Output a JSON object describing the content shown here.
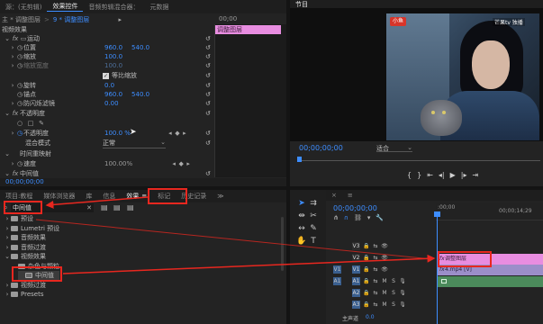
{
  "top_tabs": {
    "source": "源：(无剪辑)",
    "effect_controls": "效果控件",
    "audio_mixer": "音频剪辑混合器：",
    "metadata": "元数据",
    "program": "节目"
  },
  "effect_controls": {
    "breadcrumb_master": "主 * 调整图层",
    "breadcrumb_clip": "9 * 调整图层",
    "header_time": "00;00",
    "clip_label": "调整图层",
    "section_video": "视频效果",
    "motion": "运动",
    "position": {
      "label": "位置",
      "x": "960.0",
      "y": "540.0"
    },
    "scale": {
      "label": "缩放",
      "value": "100.0"
    },
    "scale_width": {
      "label": "缩放宽度",
      "value": "100.0"
    },
    "uniform_scale": "等比缩放",
    "rotation": {
      "label": "旋转",
      "value": "0.0"
    },
    "anchor": {
      "label": "锚点",
      "x": "960.0",
      "y": "540.0"
    },
    "flicker": {
      "label": "防闪烁滤镜",
      "value": "0.00"
    },
    "opacity": "不透明度",
    "opacity_value": {
      "label": "不透明度",
      "value": "100.0 %"
    },
    "blend": {
      "label": "混合模式",
      "value": "正常"
    },
    "time_remap": "时间重映射",
    "speed": {
      "label": "速度",
      "value": "100.00%"
    },
    "stabilizer": "中间值",
    "timecode": "00;00;00;00"
  },
  "program": {
    "timecode": "00;00;00;00",
    "fit": "适合",
    "watermark": "芒果tv 独播",
    "channel": "小鱼"
  },
  "bottom_tabs": {
    "project": "项目:教程",
    "media_browser": "媒体浏览器",
    "libraries": "库",
    "info": "信息",
    "effects": "效果",
    "markers": "标记",
    "history": "历史记录",
    "more": "≫"
  },
  "effects_panel": {
    "search_value": "中间值",
    "tree": [
      {
        "label": "预设",
        "indent": 0,
        "open": false
      },
      {
        "label": "Lumetri 预设",
        "indent": 0,
        "open": false
      },
      {
        "label": "音频效果",
        "indent": 0,
        "open": false
      },
      {
        "label": "音频过渡",
        "indent": 0,
        "open": false
      },
      {
        "label": "视频效果",
        "indent": 0,
        "open": true
      },
      {
        "label": "杂色与颗粒",
        "indent": 1,
        "open": true
      },
      {
        "label": "中间值",
        "indent": 2,
        "open": false,
        "item": true
      },
      {
        "label": "视频过渡",
        "indent": 0,
        "open": false
      },
      {
        "label": "Presets",
        "indent": 0,
        "open": false
      }
    ]
  },
  "timeline": {
    "timecode": "00;00;00;00",
    "ruler_start": ":00;00",
    "ruler_mid": "00;00;14;29",
    "tracks": [
      {
        "name": "V3",
        "type": "video"
      },
      {
        "name": "V2",
        "type": "video"
      },
      {
        "name": "V1",
        "type": "video"
      },
      {
        "name": "A1",
        "type": "audio"
      },
      {
        "name": "A2",
        "type": "audio"
      },
      {
        "name": "A3",
        "type": "audio"
      }
    ],
    "master_label": "主声道",
    "master_value": "0.0",
    "clip_adjustment": "调整图层",
    "clip_video": "4.mp4 [V]"
  },
  "colors": {
    "accent": "#3d8dff",
    "annotation_red": "#e8271f",
    "adjustment_clip": "#e88de0",
    "video_clip": "#9b8ec9",
    "audio_clip": "#4b8a5b"
  }
}
